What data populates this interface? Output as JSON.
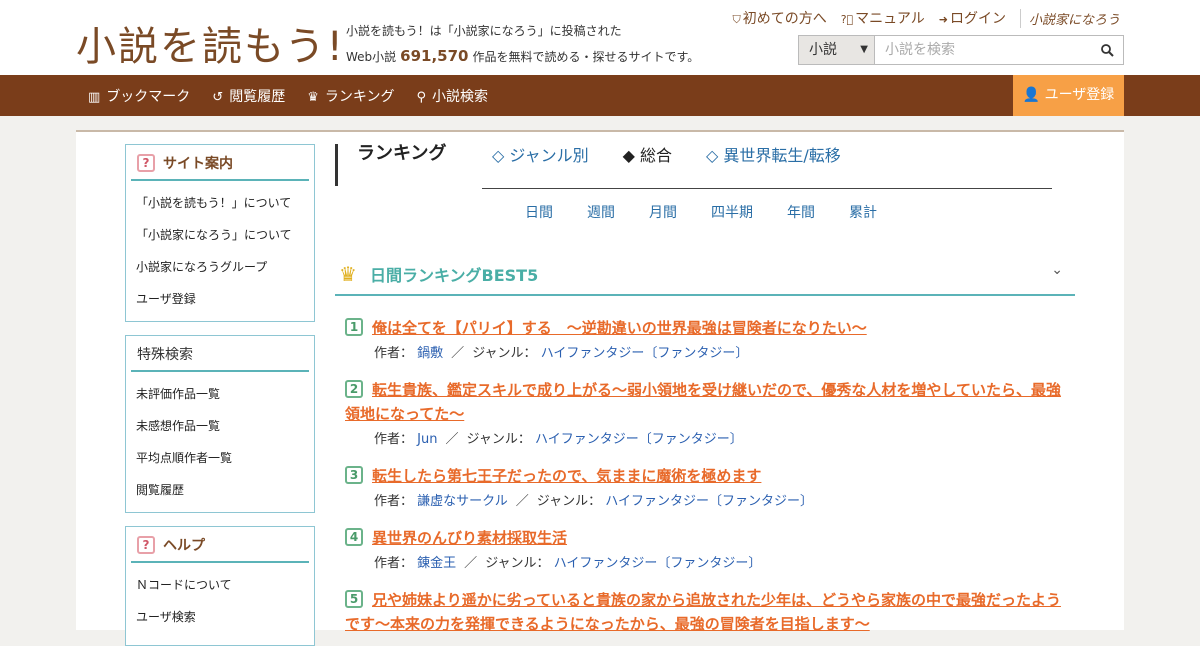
{
  "header": {
    "logo_text": "小説を読もう!",
    "tagline_line1": "小説を読もう！は「小説家になろう」に投稿された",
    "tagline_prefix": "Web小説",
    "work_count": "691,570",
    "tagline_suffix": "作品を無料で読める・探せるサイトです。",
    "links": [
      {
        "label": "初めての方へ",
        "icon": "shield-icon"
      },
      {
        "label": "マニュアル",
        "icon": "question-circle-icon"
      },
      {
        "label": "ログイン",
        "icon": "login-icon"
      }
    ],
    "narou_logo": "小説家になろう",
    "search": {
      "category": "小説",
      "placeholder": "小説を検索"
    }
  },
  "nav": {
    "items": [
      {
        "label": "ブックマーク",
        "icon": "bookmark-icon"
      },
      {
        "label": "閲覧履歴",
        "icon": "history-icon"
      },
      {
        "label": "ランキング",
        "icon": "crown-icon"
      },
      {
        "label": "小説検索",
        "icon": "search-icon"
      }
    ],
    "register": "ユーザ登録"
  },
  "sidebar": {
    "site_guide": {
      "title": "サイト案内",
      "items": [
        "「小説を読もう！」について",
        "「小説家になろう」について",
        "小説家になろうグループ",
        "ユーザ登録"
      ]
    },
    "special_search": {
      "title": "特殊検索",
      "items": [
        "未評価作品一覧",
        "未感想作品一覧",
        "平均点順作者一覧",
        "閲覧履歴"
      ]
    },
    "help": {
      "title": "ヘルプ",
      "items": [
        "Ｎコードについて",
        "ユーザ検索"
      ]
    }
  },
  "ranking": {
    "title": "ランキング",
    "tabs": [
      "◇ ジャンル別",
      "◆ 総合",
      "◇ 異世界転生/転移"
    ],
    "periods": [
      "日間",
      "週間",
      "月間",
      "四半期",
      "年間",
      "累計"
    ],
    "best_title": "日間ランキングBEST5",
    "author_label": "作者：",
    "genre_label": "ジャンル：",
    "entries": [
      {
        "rank": "1",
        "title": "俺は全てを【パリイ】する　〜逆勘違いの世界最強は冒険者になりたい〜",
        "author": "鍋敷",
        "genre": "ハイファンタジー〔ファンタジー〕"
      },
      {
        "rank": "2",
        "title": "転生貴族、鑑定スキルで成り上がる～弱小領地を受け継いだので、優秀な人材を増やしていたら、最強領地になってた～",
        "author": "Jun",
        "genre": "ハイファンタジー〔ファンタジー〕"
      },
      {
        "rank": "3",
        "title": "転生したら第七王子だったので、気ままに魔術を極めます",
        "author": "謙虚なサークル",
        "genre": "ハイファンタジー〔ファンタジー〕"
      },
      {
        "rank": "4",
        "title": "異世界のんびり素材採取生活",
        "author": "錬金王",
        "genre": "ハイファンタジー〔ファンタジー〕"
      },
      {
        "rank": "5",
        "title": "兄や姉妹より遥かに劣っていると貴族の家から追放された少年は、どうやら家族の中で最強だったようです～本来の力を発揮できるようになったから、最強の冒険者を目指します～",
        "author": "",
        "genre": ""
      }
    ]
  }
}
